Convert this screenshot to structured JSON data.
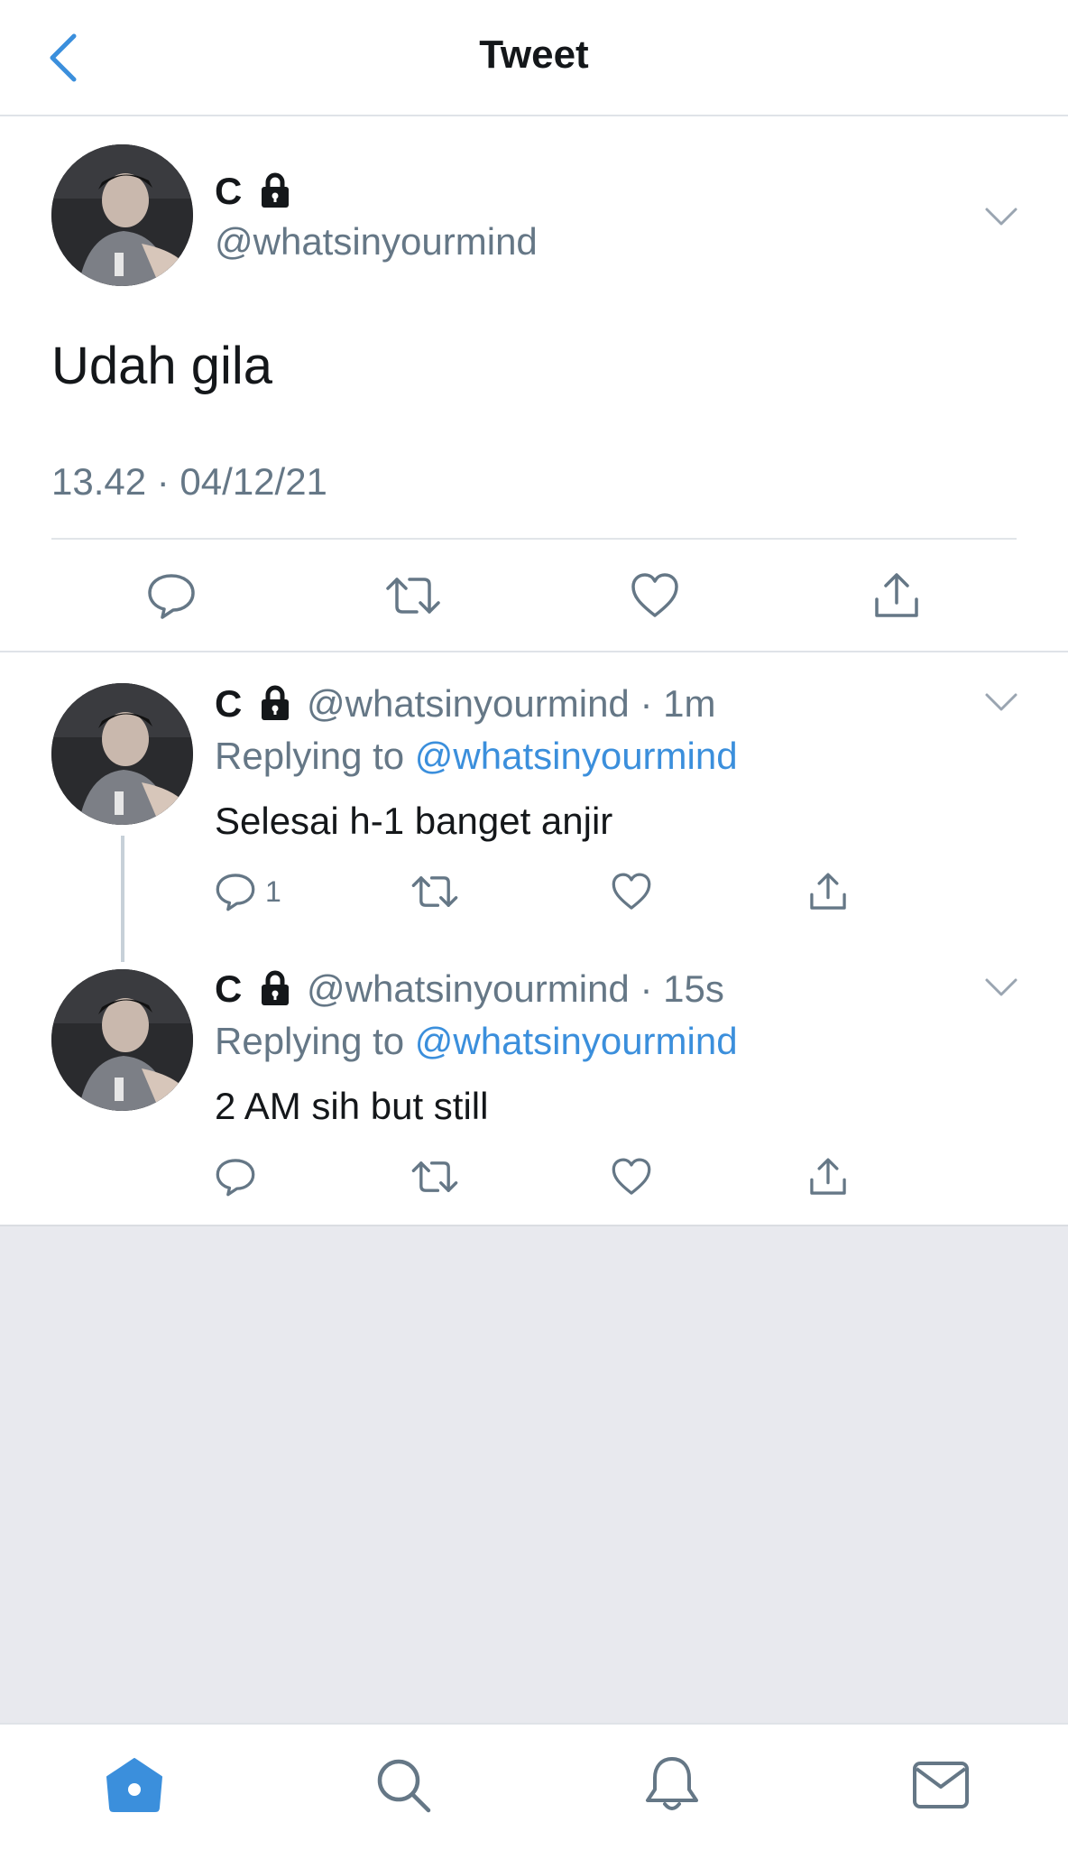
{
  "header": {
    "title": "Tweet"
  },
  "main_tweet": {
    "name": "C",
    "handle": "@whatsinyourmind",
    "text": "Udah gila",
    "timestamp": "13.42 · 04/12/21"
  },
  "replies": [
    {
      "name": "C",
      "handle": "@whatsinyourmind",
      "time": "1m",
      "replying_label": "Replying to",
      "replying_to": "@whatsinyourmind",
      "text": "Selesai h-1 banget anjir",
      "reply_count": "1"
    },
    {
      "name": "C",
      "handle": "@whatsinyourmind",
      "time": "15s",
      "replying_label": "Replying to",
      "replying_to": "@whatsinyourmind",
      "text": "2 AM sih but still",
      "reply_count": ""
    }
  ],
  "tabbar": {
    "items": [
      "home-icon",
      "search-icon",
      "notifications-icon",
      "messages-icon"
    ],
    "active": "home-icon"
  },
  "colors": {
    "accent": "#3b8fdc",
    "secondary_text": "#657786",
    "background_empty": "#e8e9ee"
  }
}
